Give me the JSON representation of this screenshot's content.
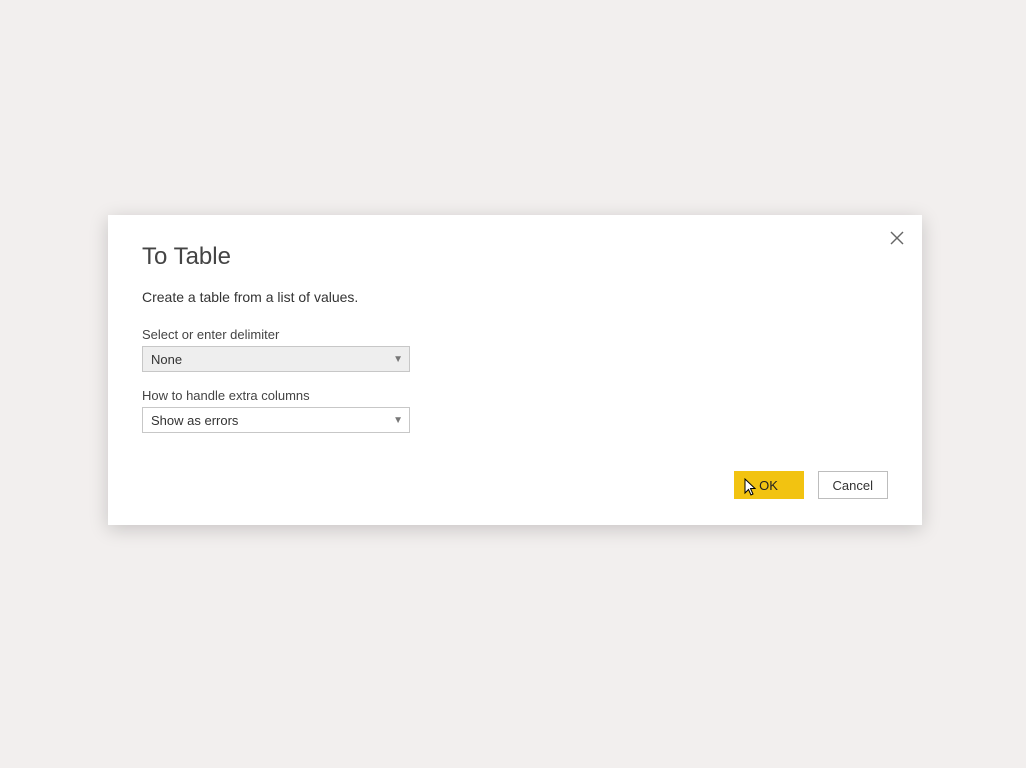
{
  "dialog": {
    "title": "To Table",
    "subtitle": "Create a table from a list of values.",
    "fields": {
      "delimiter_label": "Select or enter delimiter",
      "delimiter_value": "None",
      "extra_cols_label": "How to handle extra columns",
      "extra_cols_value": "Show as errors"
    },
    "buttons": {
      "ok": "OK",
      "cancel": "Cancel"
    }
  }
}
